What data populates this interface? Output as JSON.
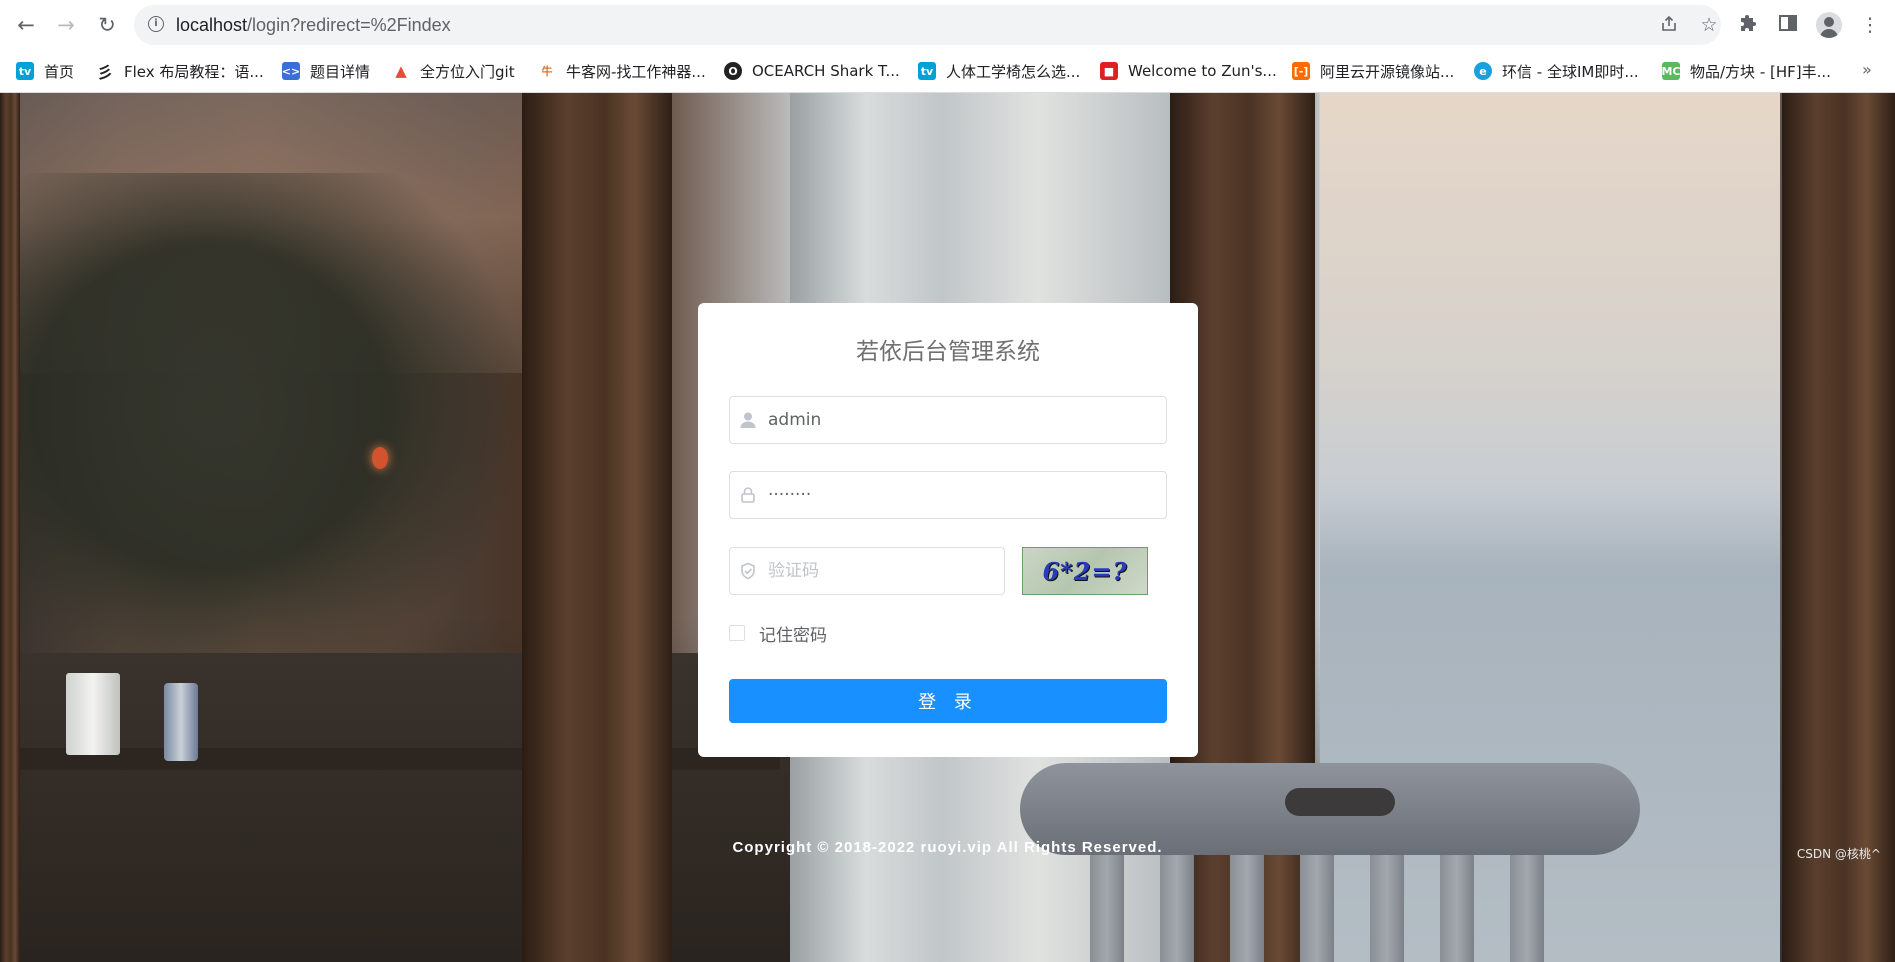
{
  "browser": {
    "url_host": "localhost",
    "url_path": "/login?redirect=%2Findex",
    "bookmarks": [
      {
        "label": "首页",
        "icon": "bilibili-icon",
        "color": "#00a1d6"
      },
      {
        "label": "Flex 布局教程：语...",
        "icon": "ink-icon",
        "color": "#222222"
      },
      {
        "label": "题目详情",
        "icon": "code-icon",
        "color": "#3a6fd8"
      },
      {
        "label": "全方位入门git",
        "icon": "flame-icon",
        "color": "#e74c3c"
      },
      {
        "label": "牛客网-找工作神器...",
        "icon": "nowcoder-icon",
        "color": "#d8782f"
      },
      {
        "label": "OCEARCH Shark T...",
        "icon": "ocearch-icon",
        "color": "#222222"
      },
      {
        "label": "人体工学椅怎么选...",
        "icon": "bilibili-icon",
        "color": "#00a1d6"
      },
      {
        "label": "Welcome to Zun's...",
        "icon": "openshift-icon",
        "color": "#e02020"
      },
      {
        "label": "阿里云开源镜像站...",
        "icon": "aliyun-icon",
        "color": "#ff6a00"
      },
      {
        "label": "环信 - 全球IM即时...",
        "icon": "easemob-icon",
        "color": "#1a9fe0"
      },
      {
        "label": "物品/方块 - [HF]丰...",
        "icon": "mcmod-icon",
        "color": "#5cb85c"
      }
    ],
    "more_label": "»"
  },
  "login": {
    "title": "若依后台管理系统",
    "username_value": "admin",
    "password_value": "········",
    "captcha_placeholder": "验证码",
    "captcha_text": "6*2=?",
    "remember_label": "记住密码",
    "remember_checked": false,
    "submit_label": "登 录"
  },
  "footer": {
    "copyright": "Copyright © 2018-2022 ruoyi.vip All Rights Reserved.",
    "watermark": "CSDN @核桃^"
  },
  "colors": {
    "primary_button": "#1890ff",
    "card_background": "#ffffff"
  }
}
